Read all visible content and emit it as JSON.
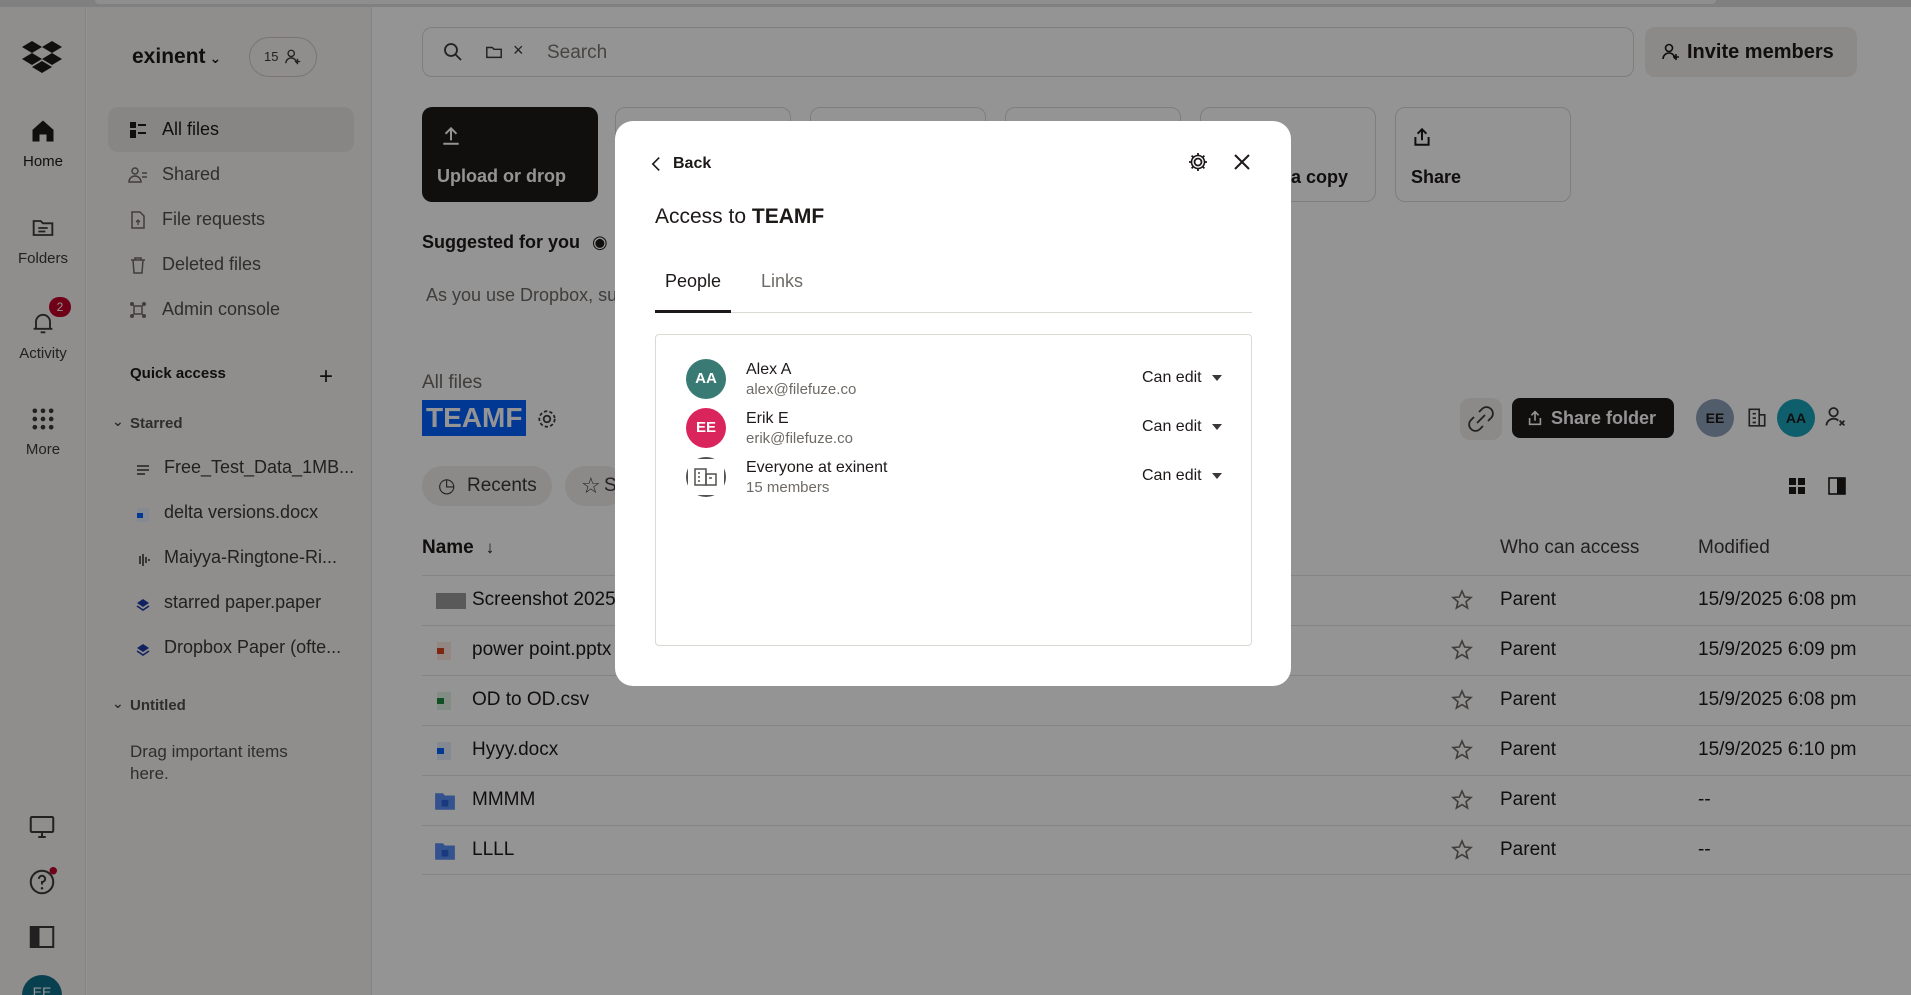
{
  "org": {
    "name": "exinent",
    "member_count": "15"
  },
  "rail": {
    "items": [
      {
        "label": "Home"
      },
      {
        "label": "Folders"
      },
      {
        "label": "Activity",
        "badge": "2"
      },
      {
        "label": "More"
      }
    ],
    "avatar": "EE"
  },
  "sidebar": {
    "nav": [
      {
        "label": "All files",
        "icon": "all-files-icon"
      },
      {
        "label": "Shared",
        "icon": "shared-icon"
      },
      {
        "label": "File requests",
        "icon": "file-requests-icon"
      },
      {
        "label": "Deleted files",
        "icon": "trash-icon"
      },
      {
        "label": "Admin console",
        "icon": "admin-icon"
      }
    ],
    "quick_access": "Quick access",
    "starred_title": "Starred",
    "starred": [
      "Free_Test_Data_1MB...",
      "delta versions.docx",
      "Maiyya-Ringtone-Ri...",
      "starred paper.paper",
      "Dropbox Paper (ofte..."
    ],
    "untitled_title": "Untitled",
    "drag_hint": "Drag important items here."
  },
  "search": {
    "placeholder": "Search"
  },
  "invite_label": "Invite members",
  "actions": {
    "upload": "Upload or drop",
    "copy": "a copy",
    "share": "Share"
  },
  "suggested": {
    "title": "Suggested for you",
    "text": "As you use Dropbox, su"
  },
  "breadcrumb": "All files",
  "folder_name": "TEAMF",
  "chips": {
    "recents": "Recents",
    "starred_partial": "S"
  },
  "share_folder_label": "Share folder",
  "header_avatars": {
    "ee": "EE",
    "aa": "AA"
  },
  "table": {
    "headers": {
      "name": "Name",
      "who": "Who can access",
      "modified": "Modified"
    },
    "rows": [
      {
        "name": "Screenshot 2025",
        "who": "Parent",
        "modified": "15/9/2025 6:08 pm"
      },
      {
        "name": "power point.pptx",
        "who": "Parent",
        "modified": "15/9/2025 6:09 pm"
      },
      {
        "name": "OD to OD.csv",
        "who": "Parent",
        "modified": "15/9/2025 6:08 pm"
      },
      {
        "name": "Hyyy.docx",
        "who": "Parent",
        "modified": "15/9/2025 6:10 pm"
      },
      {
        "name": "MMMM",
        "who": "Parent",
        "modified": "--"
      },
      {
        "name": "LLLL",
        "who": "Parent",
        "modified": "--"
      }
    ]
  },
  "modal": {
    "back": "Back",
    "title_prefix": "Access to ",
    "title_name": "TEAMF",
    "tabs": [
      "People",
      "Links"
    ],
    "people": [
      {
        "initials": "AA",
        "name": "Alex A",
        "email": "alex@filefuze.co",
        "permission": "Can edit",
        "color": "#3a7a74"
      },
      {
        "initials": "EE",
        "name": "Erik E",
        "email": "erik@filefuze.co",
        "permission": "Can edit",
        "color": "#d9245c"
      },
      {
        "initials": "",
        "name": "Everyone at exinent",
        "email": "15 members",
        "permission": "Can edit",
        "color": "#ffffff"
      }
    ]
  },
  "colors": {
    "primary": "#0061fe",
    "dark": "#1e1919",
    "badge": "#c1002a"
  }
}
